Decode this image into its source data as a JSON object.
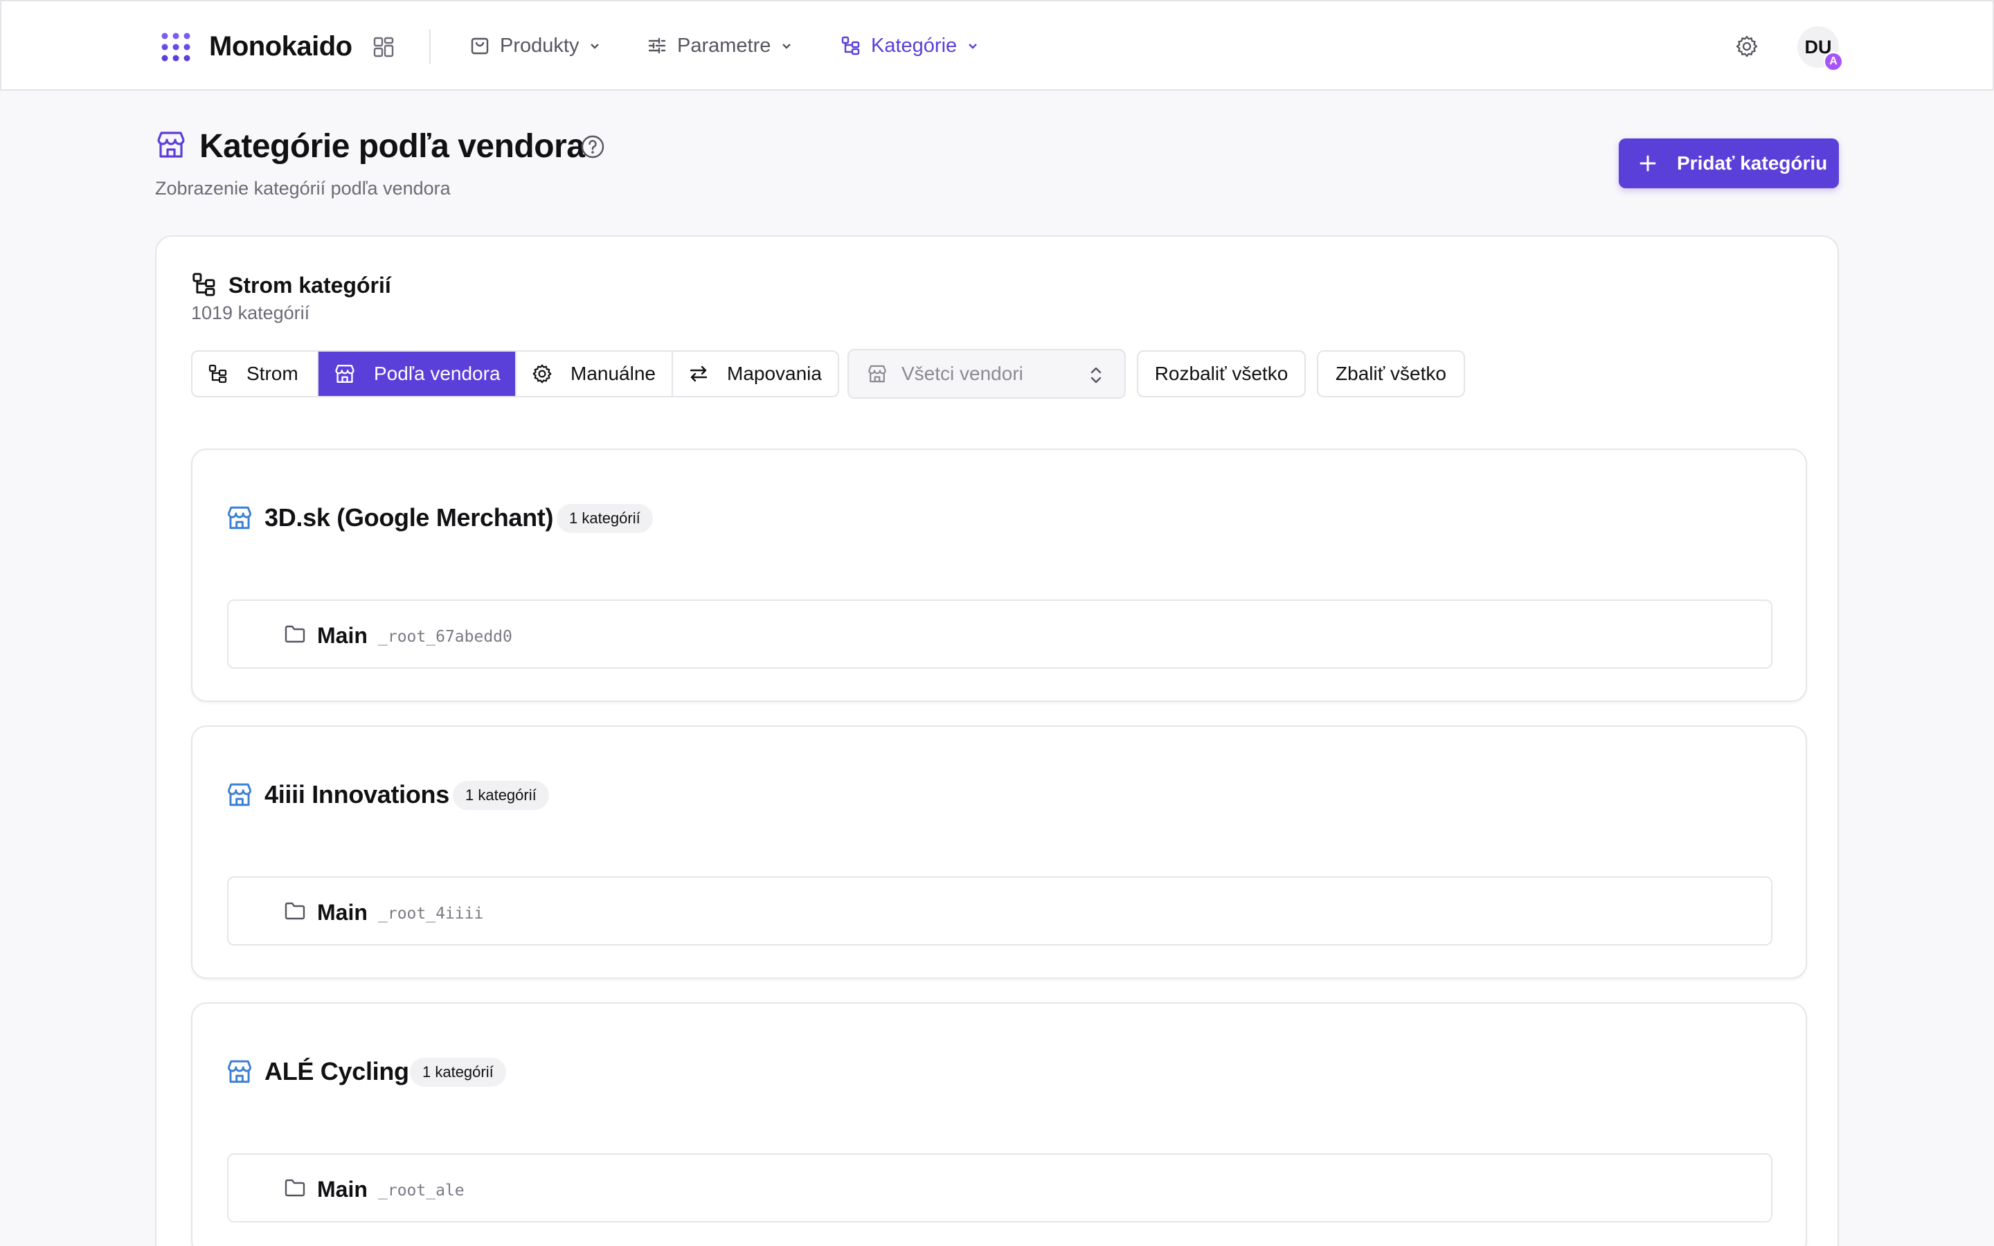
{
  "header": {
    "brand": "Monokaido",
    "nav": [
      {
        "label": "Produkty",
        "icon": "shopping-bag-icon",
        "active": false
      },
      {
        "label": "Parametre",
        "icon": "sliders-icon",
        "active": false
      },
      {
        "label": "Kategórie",
        "icon": "category-tree-icon",
        "active": true
      }
    ],
    "user_initials": "DU",
    "user_badge": "A"
  },
  "page": {
    "title": "Kategórie podľa vendora",
    "subtitle": "Zobrazenie kategórií podľa vendora",
    "add_button": "Pridať kategóriu"
  },
  "card": {
    "title": "Strom kategórií",
    "count": "1019 kategórií",
    "view_tabs": [
      {
        "label": "Strom",
        "icon": "category-tree-icon",
        "active": false
      },
      {
        "label": "Podľa vendora",
        "icon": "store-icon",
        "active": true
      },
      {
        "label": "Manuálne",
        "icon": "gear-icon",
        "active": false
      },
      {
        "label": "Mapovania",
        "icon": "swap-arrows-icon",
        "active": false
      }
    ],
    "vendor_select": {
      "placeholder": "Všetci vendori"
    },
    "expand_all": "Rozbaliť všetko",
    "collapse_all": "Zbaliť všetko"
  },
  "vendors": [
    {
      "name": "3D.sk (Google Merchant)",
      "badge": "1 kategórií",
      "category": {
        "label": "Main",
        "code": "_root_67abedd0"
      }
    },
    {
      "name": "4iiii Innovations",
      "badge": "1 kategórií",
      "category": {
        "label": "Main",
        "code": "_root_4iiii"
      }
    },
    {
      "name": "ALÉ Cycling",
      "badge": "1 kategórií",
      "category": {
        "label": "Main",
        "code": "_root_ale"
      }
    }
  ],
  "colors": {
    "accent": "#5b3fd9",
    "vendor_icon": "#3b7fd4",
    "avatar_badge": "#a855f7"
  }
}
